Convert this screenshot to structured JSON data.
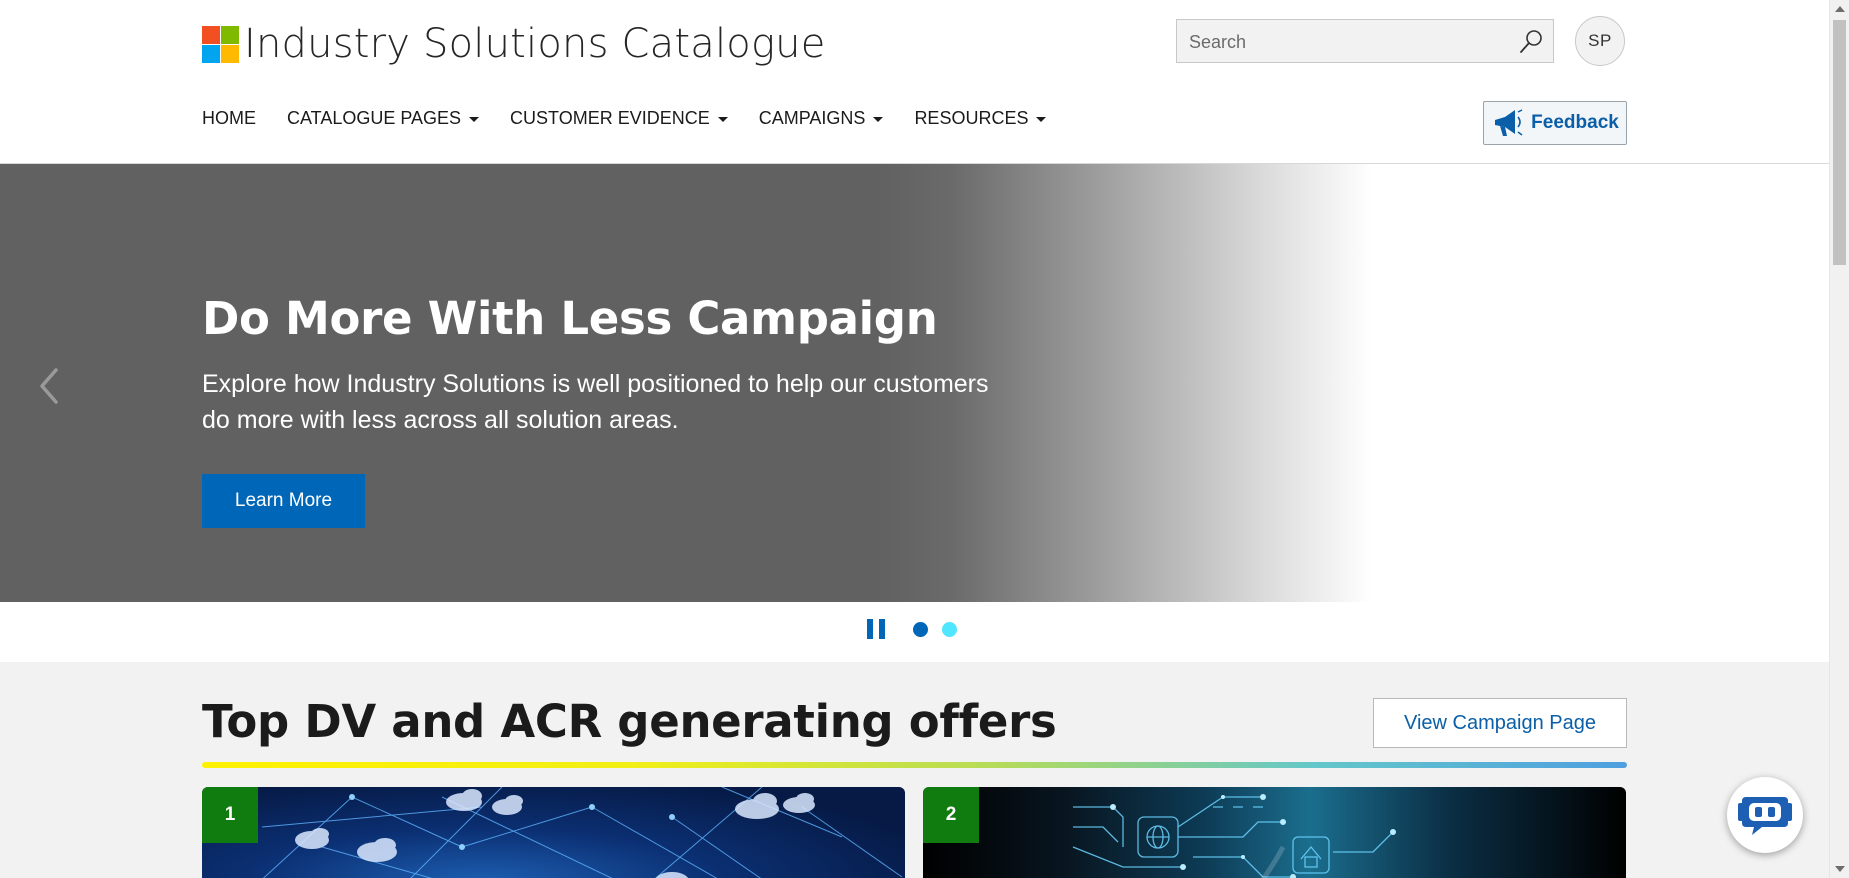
{
  "header": {
    "brand_title": "Industry Solutions Catalogue",
    "logo_colors": [
      "#f25022",
      "#7fba00",
      "#00a4ef",
      "#ffb900"
    ],
    "search_placeholder": "Search",
    "avatar_initials": "SP",
    "feedback_label": "Feedback",
    "nav": [
      {
        "label": "HOME",
        "dropdown": false
      },
      {
        "label": "CATALOGUE PAGES",
        "dropdown": true
      },
      {
        "label": "CUSTOMER EVIDENCE",
        "dropdown": true
      },
      {
        "label": "CAMPAIGNS",
        "dropdown": true
      },
      {
        "label": "RESOURCES",
        "dropdown": true
      }
    ]
  },
  "hero": {
    "title": "Do More With Less Campaign",
    "description": "Explore how Industry Solutions is well positioned to help our customers do more with less across all solution areas.",
    "button_label": "Learn More",
    "slides": [
      {
        "active": true,
        "color": "#0067b8"
      },
      {
        "active": false,
        "color": "#50e6ff"
      }
    ]
  },
  "section": {
    "title": "Top DV and ACR generating offers",
    "campaign_button_label": "View Campaign Page",
    "cards": [
      {
        "rank": "1"
      },
      {
        "rank": "2"
      }
    ]
  },
  "colors": {
    "accent": "#0067b8",
    "badge_green": "#107c10",
    "hero_gray": "#616161"
  },
  "icons": {
    "search": "search-icon",
    "feedback": "megaphone-icon",
    "prev": "chevron-left-icon",
    "pause": "pause-icon",
    "chatbot": "chatbot-icon"
  }
}
